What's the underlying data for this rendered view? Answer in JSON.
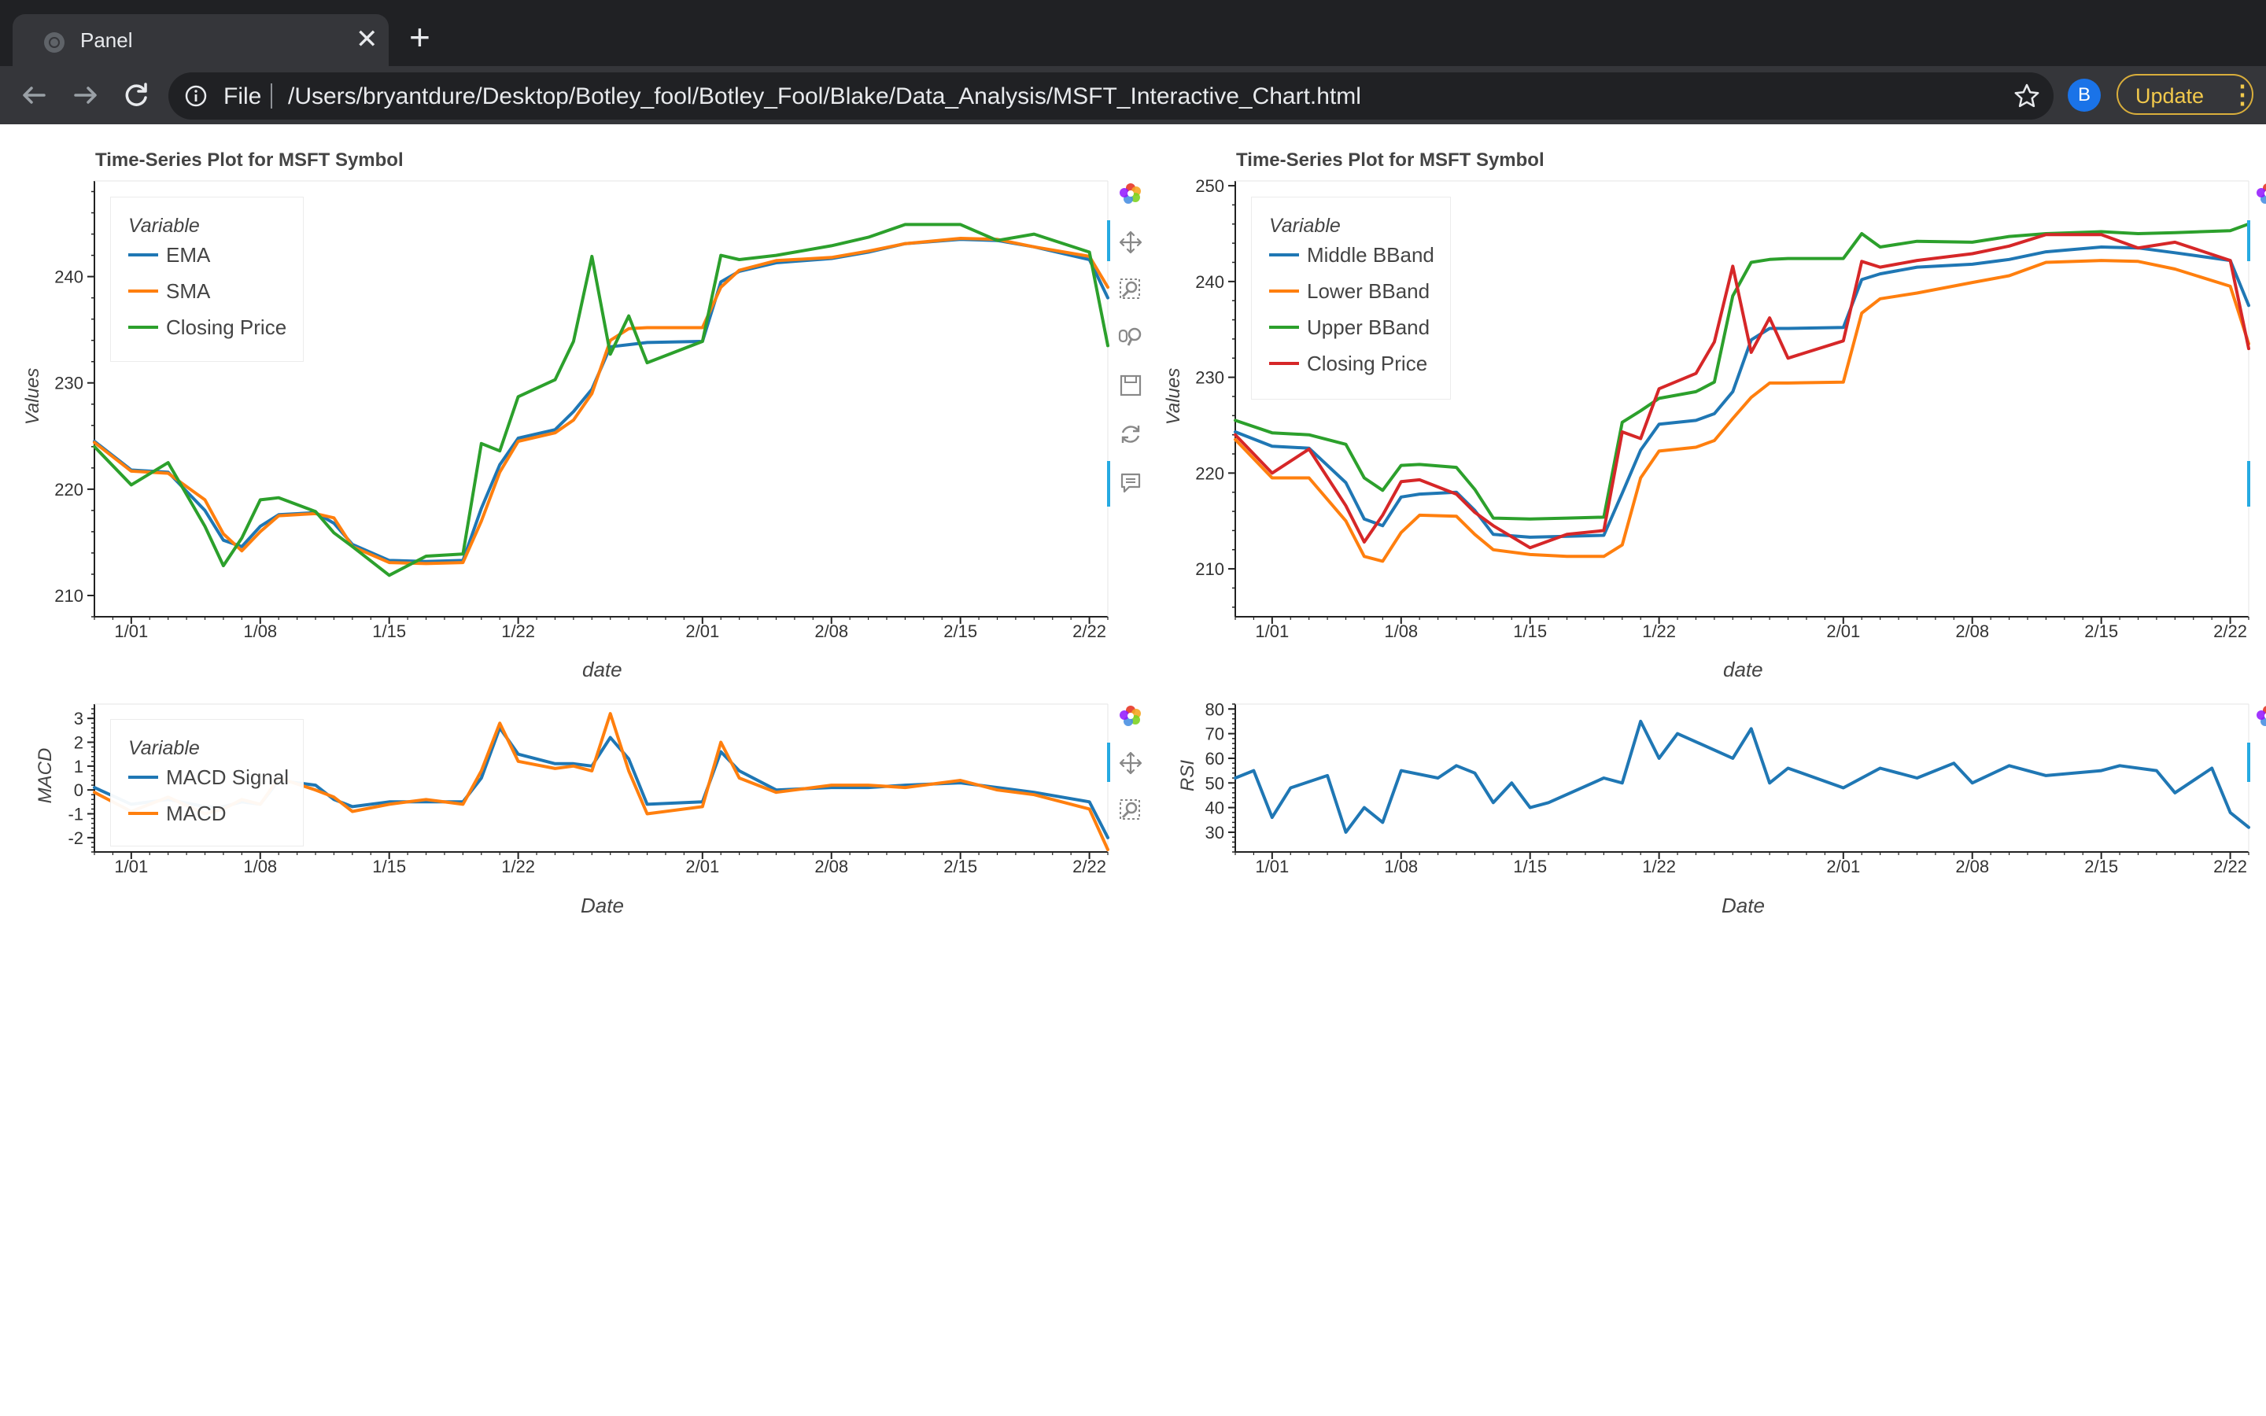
{
  "browser": {
    "tab_title": "Panel",
    "url_scheme": "File",
    "url": "/Users/bryantdure/Desktop/Botley_fool/Botley_Fool/Blake/Data_Analysis/MSFT_Interactive_Chart.html",
    "profile_initial": "B",
    "update_label": "Update"
  },
  "colors": {
    "blue": "#1f77b4",
    "orange": "#ff7f0e",
    "green": "#2ca02c",
    "red": "#d62728"
  },
  "chart_data": [
    {
      "type": "line",
      "title": "Time-Series Plot for MSFT Symbol",
      "xlabel": "date",
      "ylabel": "Values",
      "x_ticks": [
        "1/01",
        "1/08",
        "1/15",
        "1/22",
        "2/01",
        "2/08",
        "2/15",
        "2/22"
      ],
      "y_ticks": [
        210,
        220,
        230,
        240
      ],
      "xlim": [
        "2020-12-30",
        "2021-02-23"
      ],
      "ylim": [
        208,
        249
      ],
      "legend": {
        "title": "Variable",
        "placement": "top-left"
      },
      "x": [
        "2020-12-30",
        "2021-01-01",
        "2021-01-03",
        "2021-01-05",
        "2021-01-06",
        "2021-01-07",
        "2021-01-08",
        "2021-01-09",
        "2021-01-11",
        "2021-01-12",
        "2021-01-13",
        "2021-01-15",
        "2021-01-17",
        "2021-01-19",
        "2021-01-20",
        "2021-01-21",
        "2021-01-22",
        "2021-01-24",
        "2021-01-25",
        "2021-01-26",
        "2021-01-27",
        "2021-01-28",
        "2021-01-29",
        "2021-02-01",
        "2021-02-02",
        "2021-02-03",
        "2021-02-05",
        "2021-02-08",
        "2021-02-10",
        "2021-02-12",
        "2021-02-15",
        "2021-02-17",
        "2021-02-19",
        "2021-02-22",
        "2021-02-23"
      ],
      "series": [
        {
          "name": "EMA",
          "values": [
            224.5,
            221.8,
            221.6,
            218,
            215.2,
            214.6,
            216.5,
            217.6,
            217.8,
            216.8,
            214.8,
            213.3,
            213.2,
            213.3,
            218.2,
            222.3,
            224.8,
            225.6,
            227.3,
            229.4,
            233.4,
            233.6,
            233.8,
            233.9,
            239.5,
            240.5,
            241.3,
            241.7,
            242.3,
            243.1,
            243.5,
            243.4,
            242.8,
            241.6,
            238.0
          ]
        },
        {
          "name": "SMA",
          "values": [
            224.4,
            221.7,
            221.5,
            219,
            215.8,
            214.2,
            216.0,
            217.5,
            217.7,
            217.3,
            214.6,
            213.1,
            213.0,
            213.1,
            217.0,
            221.6,
            224.5,
            225.3,
            226.5,
            229.0,
            234.0,
            235.1,
            235.2,
            235.2,
            239.0,
            240.6,
            241.5,
            241.8,
            242.4,
            243.1,
            243.6,
            243.5,
            242.8,
            241.9,
            239.0
          ]
        },
        {
          "name": "Closing Price",
          "values": [
            224.0,
            220.4,
            222.5,
            216.5,
            212.8,
            215.4,
            219.0,
            219.2,
            217.9,
            215.9,
            214.6,
            211.9,
            213.7,
            213.9,
            224.3,
            223.6,
            228.7,
            230.3,
            233.9,
            241.9,
            232.7,
            236.3,
            231.9,
            233.9,
            242.0,
            241.6,
            242.0,
            242.9,
            243.7,
            244.9,
            244.9,
            243.4,
            244.0,
            242.3,
            233.5
          ]
        }
      ]
    },
    {
      "type": "line",
      "title": "Time-Series Plot for MSFT Symbol",
      "xlabel": "date",
      "ylabel": "Values",
      "x_ticks": [
        "1/01",
        "1/08",
        "1/15",
        "1/22",
        "2/01",
        "2/08",
        "2/15",
        "2/22"
      ],
      "y_ticks": [
        210,
        220,
        230,
        240,
        250
      ],
      "xlim": [
        "2020-12-30",
        "2021-02-23"
      ],
      "ylim": [
        205,
        250.5
      ],
      "legend": {
        "title": "Variable",
        "placement": "top-left"
      },
      "x": [
        "2020-12-30",
        "2021-01-01",
        "2021-01-03",
        "2021-01-05",
        "2021-01-06",
        "2021-01-07",
        "2021-01-08",
        "2021-01-09",
        "2021-01-11",
        "2021-01-12",
        "2021-01-13",
        "2021-01-15",
        "2021-01-17",
        "2021-01-19",
        "2021-01-20",
        "2021-01-21",
        "2021-01-22",
        "2021-01-24",
        "2021-01-25",
        "2021-01-26",
        "2021-01-27",
        "2021-01-28",
        "2021-01-29",
        "2021-02-01",
        "2021-02-02",
        "2021-02-03",
        "2021-02-05",
        "2021-02-08",
        "2021-02-10",
        "2021-02-12",
        "2021-02-15",
        "2021-02-17",
        "2021-02-19",
        "2021-02-22",
        "2021-02-23"
      ],
      "series": [
        {
          "name": "Middle BBand",
          "values": [
            224.3,
            222.8,
            222.6,
            219.0,
            215.2,
            214.5,
            217.5,
            217.8,
            218.0,
            216.1,
            213.6,
            213.3,
            213.4,
            213.5,
            217.9,
            222.4,
            225.1,
            225.5,
            226.2,
            228.5,
            233.9,
            235.1,
            235.1,
            235.2,
            240.2,
            240.8,
            241.5,
            241.8,
            242.3,
            243.1,
            243.6,
            243.5,
            243.0,
            242.2,
            237.5
          ]
        },
        {
          "name": "Lower BBand",
          "values": [
            223.5,
            219.5,
            219.5,
            215.0,
            211.3,
            210.8,
            213.8,
            215.6,
            215.5,
            213.6,
            212.0,
            211.5,
            211.3,
            211.3,
            212.5,
            219.5,
            222.3,
            222.7,
            223.4,
            225.7,
            227.9,
            229.4,
            229.4,
            229.5,
            236.7,
            238.2,
            238.8,
            239.9,
            240.6,
            242.0,
            242.2,
            242.1,
            241.3,
            239.5,
            233.5
          ]
        },
        {
          "name": "Upper BBand",
          "values": [
            225.5,
            224.2,
            224.0,
            223.0,
            219.5,
            218.2,
            220.8,
            220.9,
            220.6,
            218.3,
            215.3,
            215.2,
            215.3,
            215.4,
            225.3,
            226.5,
            227.8,
            228.5,
            229.5,
            238.5,
            242.0,
            242.3,
            242.4,
            242.4,
            245.0,
            243.6,
            244.2,
            244.1,
            244.7,
            245.0,
            245.2,
            245.0,
            245.1,
            245.3,
            246.0
          ]
        },
        {
          "name": "Closing Price",
          "values": [
            224.0,
            220.0,
            222.5,
            216.6,
            212.8,
            215.6,
            219.1,
            219.3,
            217.8,
            215.9,
            214.5,
            212.2,
            213.6,
            214.0,
            224.3,
            223.6,
            228.8,
            230.4,
            233.7,
            241.6,
            232.6,
            236.2,
            232.0,
            233.8,
            242.1,
            241.5,
            242.2,
            242.9,
            243.7,
            244.9,
            244.9,
            243.5,
            244.1,
            242.2,
            233.0
          ]
        }
      ]
    },
    {
      "type": "line",
      "title": "",
      "xlabel": "Date",
      "ylabel": "MACD",
      "x_ticks": [
        "1/01",
        "1/08",
        "1/15",
        "1/22",
        "2/01",
        "2/08",
        "2/15",
        "2/22"
      ],
      "y_ticks": [
        -2,
        -1,
        0,
        1,
        2,
        3
      ],
      "xlim": [
        "2020-12-30",
        "2021-02-23"
      ],
      "ylim": [
        -2.6,
        3.6
      ],
      "legend": {
        "title": "Variable",
        "placement": "top-left"
      },
      "x": [
        "2020-12-30",
        "2021-01-01",
        "2021-01-03",
        "2021-01-05",
        "2021-01-06",
        "2021-01-07",
        "2021-01-08",
        "2021-01-09",
        "2021-01-11",
        "2021-01-12",
        "2021-01-13",
        "2021-01-15",
        "2021-01-17",
        "2021-01-19",
        "2021-01-20",
        "2021-01-21",
        "2021-01-22",
        "2021-01-24",
        "2021-01-25",
        "2021-01-26",
        "2021-01-27",
        "2021-01-28",
        "2021-01-29",
        "2021-02-01",
        "2021-02-02",
        "2021-02-03",
        "2021-02-05",
        "2021-02-08",
        "2021-02-10",
        "2021-02-12",
        "2021-02-15",
        "2021-02-17",
        "2021-02-19",
        "2021-02-22",
        "2021-02-23"
      ],
      "series": [
        {
          "name": "MACD Signal",
          "values": [
            0.1,
            -0.6,
            -0.4,
            -0.7,
            -0.7,
            -0.5,
            -0.6,
            0.4,
            0.2,
            -0.4,
            -0.7,
            -0.5,
            -0.5,
            -0.5,
            0.5,
            2.6,
            1.5,
            1.1,
            1.1,
            1.0,
            2.2,
            1.3,
            -0.6,
            -0.5,
            1.6,
            0.8,
            0.0,
            0.1,
            0.1,
            0.2,
            0.3,
            0.1,
            -0.1,
            -0.5,
            -2.0
          ]
        },
        {
          "name": "MACD",
          "values": [
            -0.1,
            -0.9,
            -0.3,
            -1.0,
            -0.8,
            -0.4,
            -0.6,
            0.5,
            0.0,
            -0.3,
            -0.9,
            -0.6,
            -0.4,
            -0.6,
            0.8,
            2.8,
            1.2,
            0.9,
            1.0,
            0.8,
            3.2,
            0.8,
            -1.0,
            -0.7,
            2.0,
            0.5,
            -0.1,
            0.2,
            0.2,
            0.1,
            0.4,
            0.0,
            -0.2,
            -0.8,
            -2.5
          ]
        }
      ]
    },
    {
      "type": "line",
      "title": "",
      "xlabel": "Date",
      "ylabel": "RSI",
      "x_ticks": [
        "1/01",
        "1/08",
        "1/15",
        "1/22",
        "2/01",
        "2/08",
        "2/15",
        "2/22"
      ],
      "y_ticks": [
        30,
        40,
        50,
        60,
        70,
        80
      ],
      "xlim": [
        "2020-12-30",
        "2021-02-23"
      ],
      "ylim": [
        22,
        82
      ],
      "legend": null,
      "x": [
        "2020-12-30",
        "2020-12-31",
        "2021-01-01",
        "2021-01-02",
        "2021-01-04",
        "2021-01-05",
        "2021-01-06",
        "2021-01-07",
        "2021-01-08",
        "2021-01-10",
        "2021-01-11",
        "2021-01-12",
        "2021-01-13",
        "2021-01-14",
        "2021-01-15",
        "2021-01-16",
        "2021-01-19",
        "2021-01-20",
        "2021-01-21",
        "2021-01-22",
        "2021-01-23",
        "2021-01-26",
        "2021-01-27",
        "2021-01-28",
        "2021-01-29",
        "2021-02-01",
        "2021-02-02",
        "2021-02-03",
        "2021-02-05",
        "2021-02-07",
        "2021-02-08",
        "2021-02-10",
        "2021-02-12",
        "2021-02-15",
        "2021-02-16",
        "2021-02-18",
        "2021-02-19",
        "2021-02-21",
        "2021-02-22",
        "2021-02-23"
      ],
      "series": [
        {
          "name": "",
          "values": [
            52,
            55,
            36,
            48,
            53,
            30,
            40,
            34,
            55,
            52,
            57,
            54,
            42,
            50,
            40,
            42,
            52,
            50,
            75,
            60,
            70,
            60,
            72,
            50,
            56,
            48,
            52,
            56,
            52,
            58,
            50,
            57,
            53,
            55,
            57,
            55,
            46,
            56,
            38,
            32
          ]
        }
      ]
    }
  ]
}
